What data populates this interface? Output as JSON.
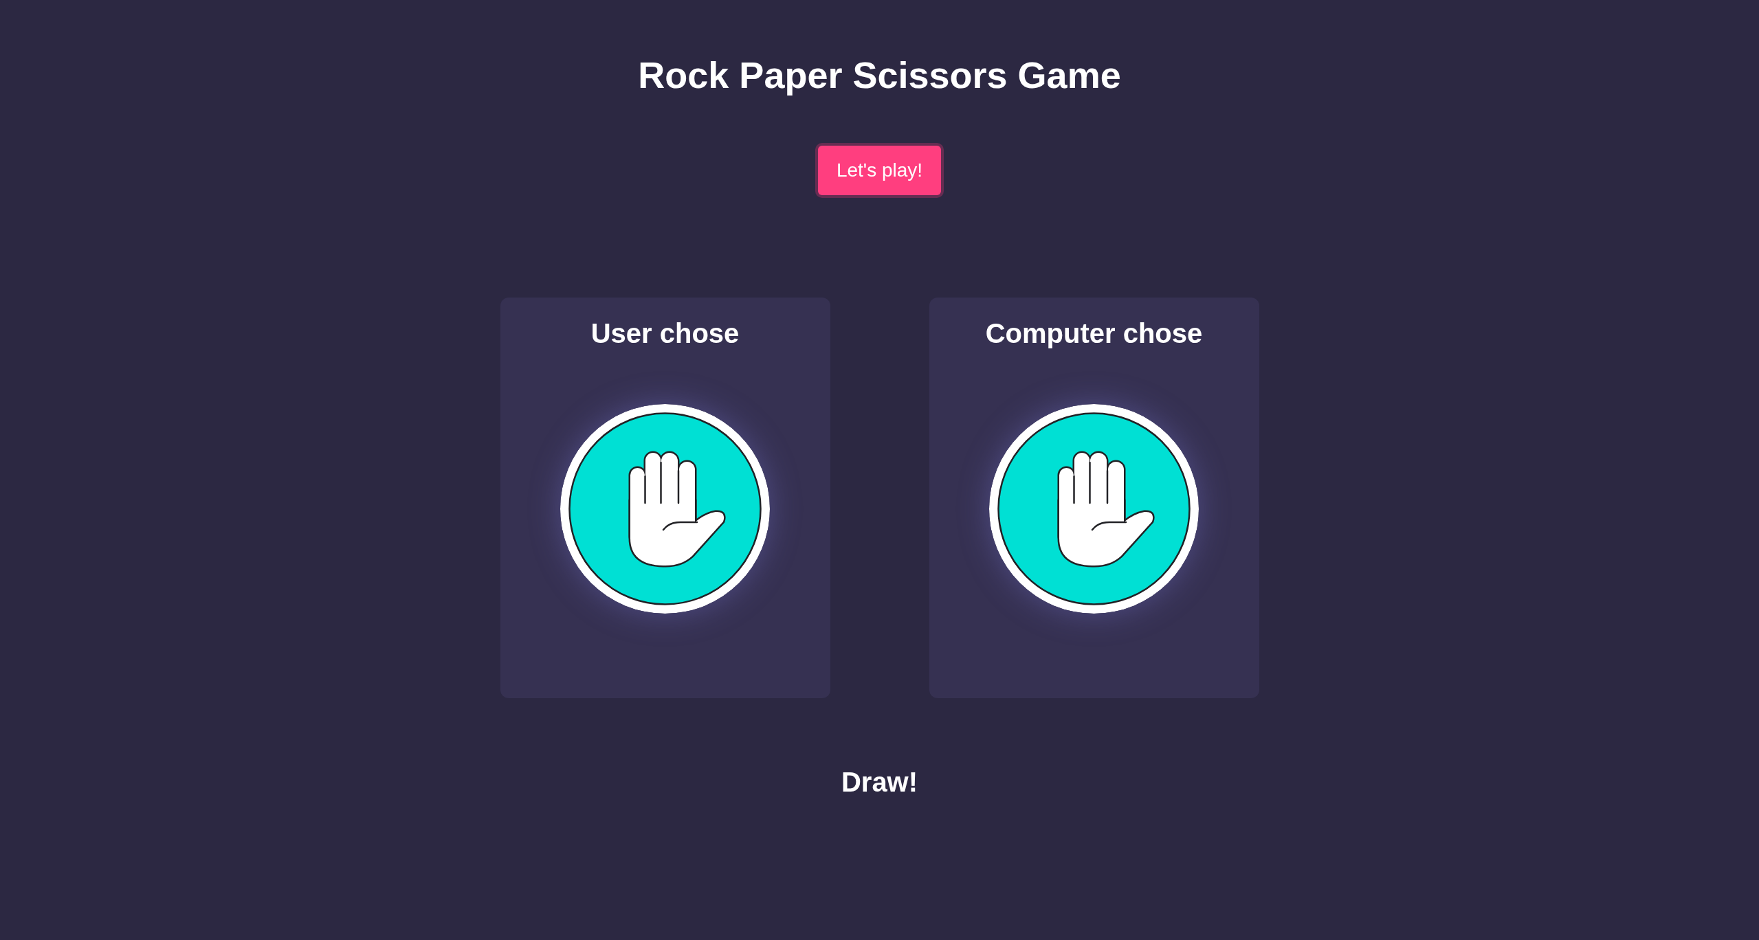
{
  "title": "Rock Paper Scissors Game",
  "play_button": {
    "label": "Let's play!",
    "focused": true
  },
  "players": [
    {
      "heading": "User chose",
      "kind": "paper"
    },
    {
      "heading": "Computer chose",
      "kind": "paper"
    }
  ],
  "result": "Draw!"
}
